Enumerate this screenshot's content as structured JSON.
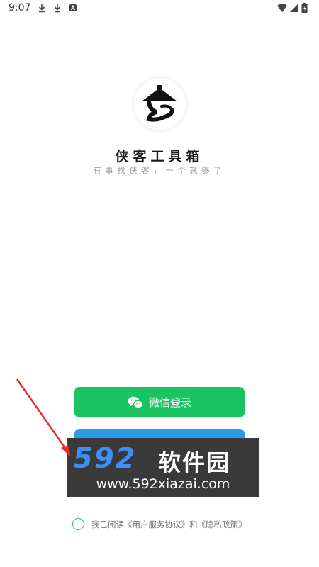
{
  "status_bar": {
    "time": "9:07"
  },
  "app": {
    "name": "侠客工具箱",
    "slogan": "有事找侠客，一个就够了"
  },
  "buttons": {
    "wechat_login": "微信登录"
  },
  "watermark": {
    "brand_number": "592",
    "brand_name": "软件园",
    "url": "www.592xiazai.com"
  },
  "agreement": {
    "text": "我已阅读《用户服务协议》和《隐私政策》"
  },
  "colors": {
    "wechat_green": "#1bc462",
    "secondary_blue": "#2e9be6",
    "arrow_red": "#e0322f"
  }
}
